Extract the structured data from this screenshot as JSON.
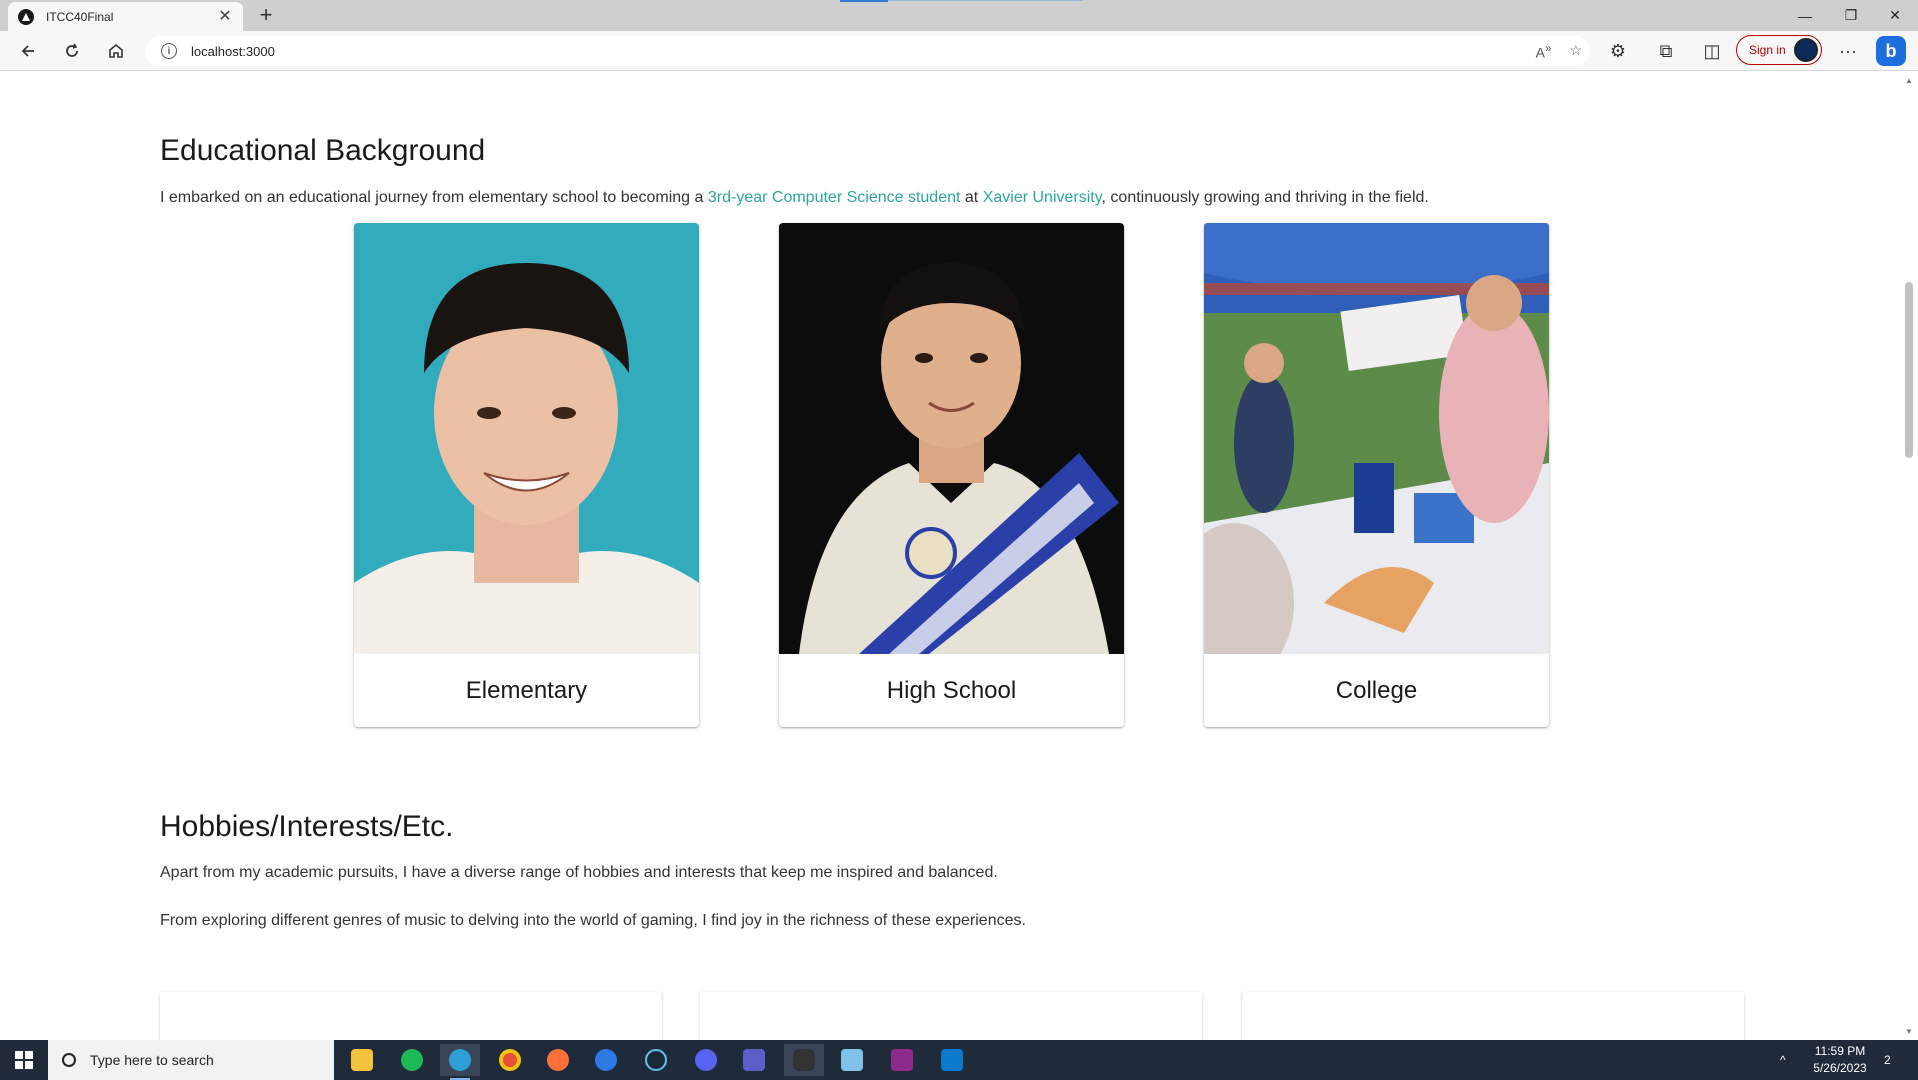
{
  "browser": {
    "tab_title": "ITCC40Final",
    "tab_close": "✕",
    "new_tab": "+",
    "url": "localhost:3000",
    "signin_label": "Sign in",
    "bing_label": "b",
    "window_min": "—",
    "window_restore": "❐",
    "window_close": "✕",
    "more": "···"
  },
  "education": {
    "title": "Educational Background",
    "intro_pre": "I embarked on an educational journey from elementary school to becoming a ",
    "intro_link1": "3rd-year Computer Science student",
    "intro_mid": " at ",
    "intro_link2": "Xavier University",
    "intro_post": ", continuously growing and thriving in the field.",
    "cards": [
      {
        "caption": "Elementary"
      },
      {
        "caption": "High School"
      },
      {
        "caption": "College"
      }
    ]
  },
  "hobbies": {
    "title": "Hobbies/Interests/Etc.",
    "para1": "Apart from my academic pursuits, I have a diverse range of hobbies and interests that keep me inspired and balanced.",
    "para2": "From exploring different genres of music to delving into the world of gaming, I find joy in the richness of these experiences."
  },
  "taskbar": {
    "search_placeholder": "Type here to search",
    "time": "11:59 PM",
    "date": "5/26/2023",
    "notification_count": "2"
  },
  "colors": {
    "link": "#2aa89a",
    "taskbar": "#1f2a3a"
  }
}
